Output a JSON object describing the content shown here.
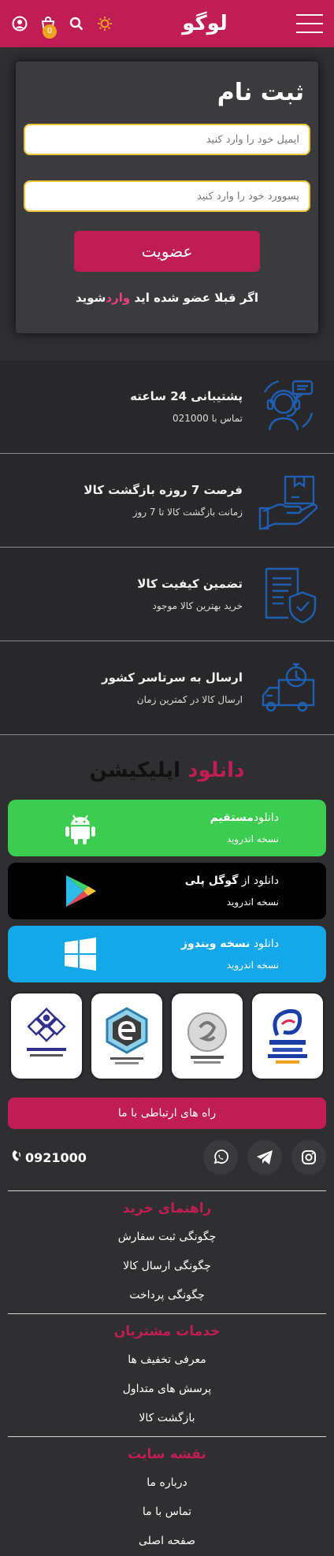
{
  "header": {
    "logo": "لوگو",
    "cart_count": "0"
  },
  "register": {
    "title": "ثبت نام",
    "email_placeholder": "ایمیل خود را وارد کنید",
    "password_placeholder": "پسوورد خود را وارد کنید",
    "submit_label": "عضویت",
    "login_prefix": "اگر قبلا عضو شده اید",
    "login_link": "وارد",
    "login_suffix": "شوید"
  },
  "features": [
    {
      "title": "پشتیبانی 24 ساعته",
      "subtitle": "تماس با 021000",
      "icon": "headset-support-icon"
    },
    {
      "title": "فرصت 7 روزه بازگشت کالا",
      "subtitle": "زمانت بازگشت کالا تا 7 روز",
      "icon": "return-box-icon"
    },
    {
      "title": "تضمین کیفیت کالا",
      "subtitle": "خرید بهترین کالا موجود",
      "icon": "quality-shield-icon"
    },
    {
      "title": "ارسال به سرتاسر کشور",
      "subtitle": "ارسال کالا در کمترین زمان",
      "icon": "delivery-truck-icon"
    }
  ],
  "download": {
    "title_accent": "دانلود",
    "title_rest": "اپلیکیشن",
    "buttons": [
      {
        "prefix": "دانلود",
        "bold": "مستقیم",
        "sub": "نسخه اندروید",
        "color": "#3ccc4f"
      },
      {
        "prefix": "دانلود از",
        "bold": "گوگل پلی",
        "sub": "نسخه اندروید",
        "color": "#000000"
      },
      {
        "prefix": "دانلود",
        "bold": "نسخه ویندوز",
        "sub": "نسخه اندروید",
        "color": "#14a8ea"
      }
    ]
  },
  "badges": [
    "enamad-badge",
    "samandehi-badge",
    "e-commerce-union-badge",
    "virtual-business-union-badge"
  ],
  "contact": {
    "button_label": "راه های ارتباطی با ما",
    "phone": "0921000"
  },
  "footer": [
    {
      "title": "راهنمای خرید",
      "links": [
        "چگونگی ثبت سفارش",
        "چگونگی ارسال کالا",
        "چگونگی پرداخت"
      ]
    },
    {
      "title": "خدمات مشتریان",
      "links": [
        "معرفی تخفیف ها",
        "پرسش های متداول",
        "بازگشت کالا"
      ]
    },
    {
      "title": "نقشه سایت",
      "links": [
        "درباره ما",
        "تماس با ما",
        "صفحه اصلی"
      ]
    }
  ],
  "colors": {
    "brand": "#c01d55",
    "android": "#3ccc4f",
    "play": "#000000",
    "windows": "#14a8ea",
    "icon_blue": "#1e5fb3"
  }
}
